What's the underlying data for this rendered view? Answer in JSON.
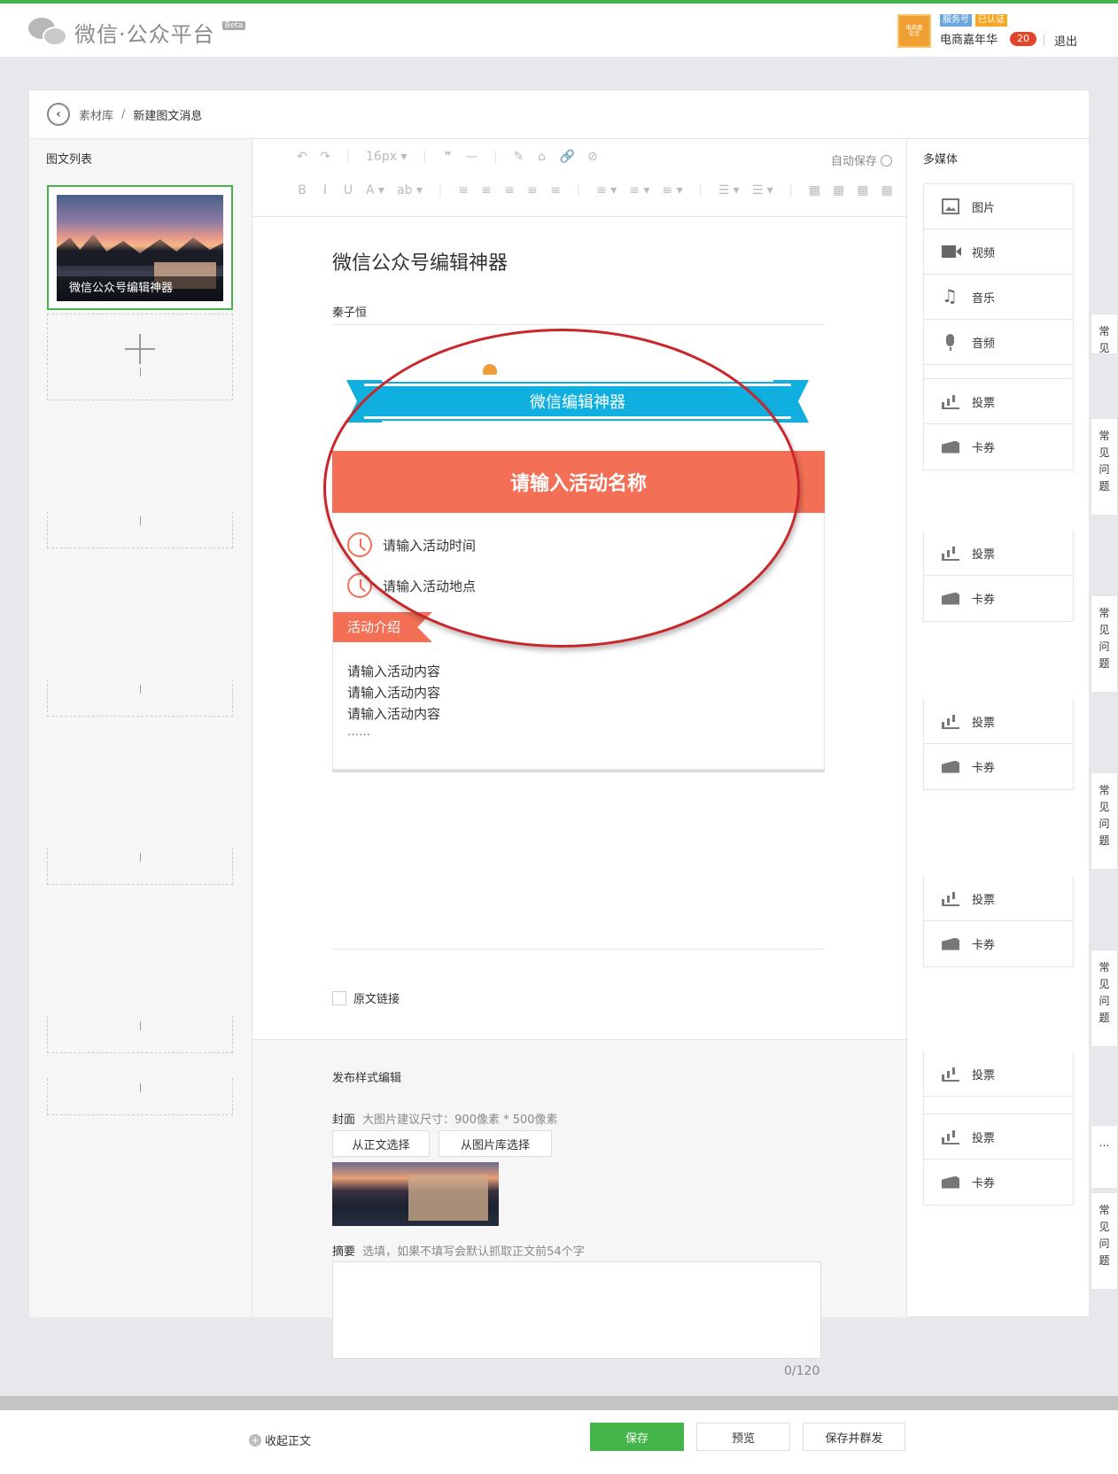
{
  "header": {
    "logo_text": "微信·公众平台",
    "beta": "Beta",
    "avatar_text": "电商嘉年华",
    "tag_service": "服务号",
    "tag_verified": "已认证",
    "account_name": "电商嘉年华",
    "notification_count": "20",
    "logout": "退出"
  },
  "breadcrumb": {
    "back_icon": "‹",
    "parent": "素材库",
    "separator": "/",
    "current": "新建图文消息"
  },
  "left": {
    "title": "图文列表",
    "first_item_caption": "微信公众号编辑神器"
  },
  "toolbar": {
    "row1": [
      "↶",
      "↷",
      "|",
      "16px ▾",
      "|",
      "❞",
      "—",
      "|",
      "✎",
      "⌂",
      "🔗",
      "⊘"
    ],
    "row2": [
      "B",
      "I",
      "U",
      "A ▾",
      "ab ▾",
      "|",
      "≡",
      "≡",
      "≡",
      "≡",
      "≡",
      "|",
      "≡ ▾",
      "≡ ▾",
      "≡ ▾",
      "|",
      "☰ ▾",
      "☰ ▾",
      "|",
      "▦",
      "▦",
      "▦",
      "▦"
    ],
    "autosave": "自动保存"
  },
  "article": {
    "title": "微信公众号编辑神器",
    "author": "秦子恒",
    "ribbon_text": "微信编辑神器",
    "activity_name": "请输入活动名称",
    "activity_time": "请输入活动时间",
    "activity_place": "请输入活动地点",
    "intro_tag": "活动介绍",
    "content_lines": [
      "请输入活动内容",
      "请输入活动内容",
      "请输入活动内容"
    ],
    "ellipsis": "……",
    "original_link": "原文链接"
  },
  "publish": {
    "title": "发布样式编辑",
    "cover_label": "封面",
    "cover_hint": "大图片建议尺寸：900像素 * 500像素",
    "btn_from_body": "从正文选择",
    "btn_from_library": "从图片库选择",
    "abstract_label": "摘要",
    "abstract_hint": "选填，如果不填写会默认抓取正文前54个字",
    "counter": "0/120"
  },
  "right": {
    "title": "多媒体",
    "items_main": [
      {
        "label": "图片",
        "icon": "image-icon"
      },
      {
        "label": "视频",
        "icon": "video-icon"
      },
      {
        "label": "音乐",
        "icon": "music-icon"
      },
      {
        "label": "音频",
        "icon": "audio-icon"
      }
    ],
    "vote": "投票",
    "card": "卡券"
  },
  "faq": {
    "label": [
      "常",
      "见",
      "问",
      "题"
    ],
    "ellipsis": "…"
  },
  "bottom": {
    "collapse": "收起正文",
    "save": "保存",
    "preview": "预览",
    "save_send": "保存并群发"
  },
  "colors": {
    "brand_green": "#44b549",
    "ribbon_blue": "#0fb0e0",
    "activity_coral": "#f36f56",
    "annotation_red": "#c8262b"
  }
}
